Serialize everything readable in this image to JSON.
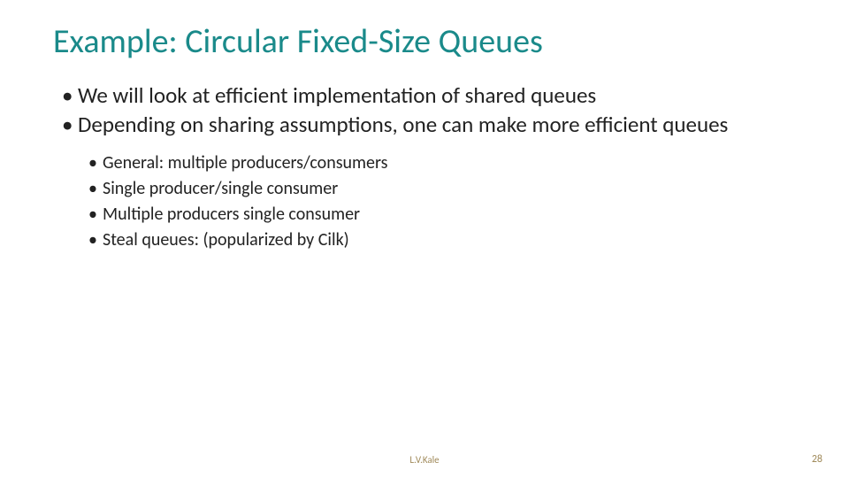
{
  "title": "Example: Circular Fixed-Size Queues",
  "bullets": {
    "l1": [
      "We will look at efficient implementation of shared queues",
      "Depending on sharing assumptions, one can make more efficient queues"
    ],
    "l2": [
      "General: multiple producers/consumers",
      "Single producer/single consumer",
      "Multiple producers single consumer",
      "Steal queues: (popularized by Cilk)"
    ]
  },
  "footer": {
    "author": "L.V.Kale",
    "page": "28"
  }
}
